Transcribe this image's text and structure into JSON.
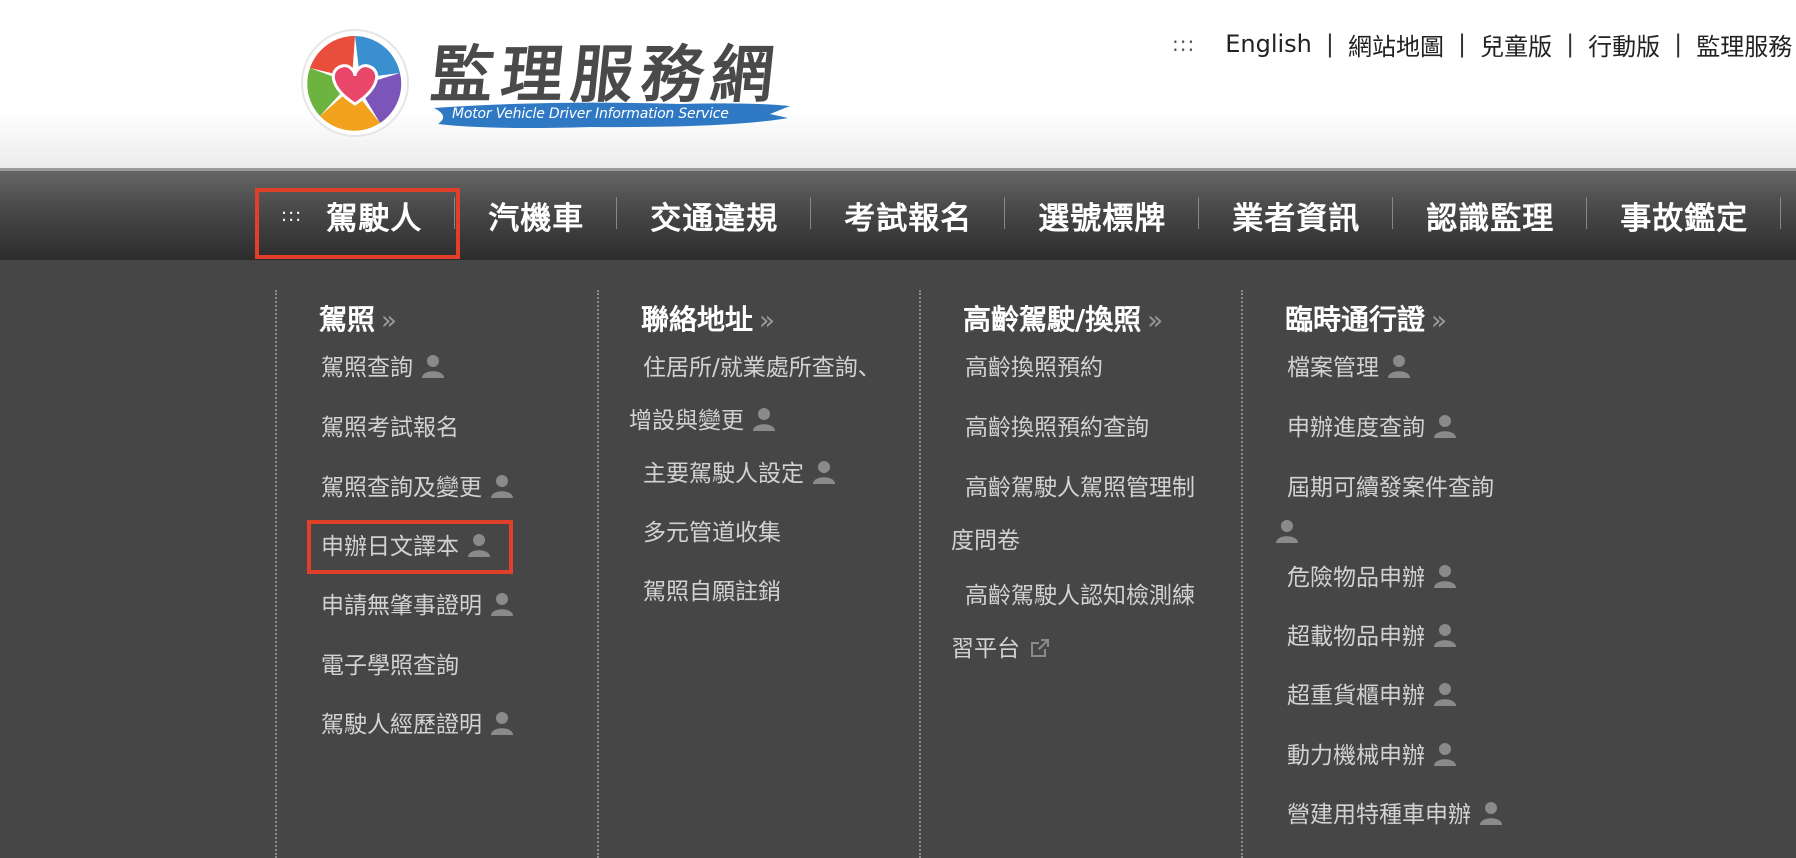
{
  "header": {
    "logo_title": "監理服務網",
    "logo_subtitle": "Motor Vehicle Driver Information Service",
    "accesskey": ":::",
    "links": [
      "English",
      "網站地圖",
      "兒童版",
      "行動版",
      "監理服務"
    ]
  },
  "nav": {
    "accesskey": ":::",
    "items": [
      "駕駛人",
      "汽機車",
      "交通違規",
      "考試報名",
      "選號標牌",
      "業者資訊",
      "認識監理",
      "事故鑑定"
    ],
    "active": "駕駛人"
  },
  "menu": {
    "col1": {
      "title": "駕照",
      "items": [
        "駕照查詢",
        "駕照考試報名",
        "駕照查詢及變更",
        "申辦日文譯本",
        "申請無肇事證明",
        "電子學照查詢",
        "駕駛人經歷證明"
      ]
    },
    "col2": {
      "title": "聯絡地址",
      "items": [
        "住居所/就業處所查詢、",
        "增設與變更",
        "主要駕駛人設定",
        "多元管道收集",
        "駕照自願註銷"
      ]
    },
    "col3": {
      "title": "高齡駕駛/換照",
      "items": [
        "高齡換照預約",
        "高齡換照預約查詢",
        "高齡駕駛人駕照管理制",
        "度問卷",
        "高齡駕駛人認知檢測練",
        "習平台"
      ]
    },
    "col4": {
      "title": "臨時通行證",
      "items": [
        "檔案管理",
        "申辦進度查詢",
        "屆期可續發案件查詢",
        "危險物品申辦",
        "超載物品申辦",
        "超重貨櫃申辦",
        "動力機械申辦",
        "營建用特種車申辦"
      ]
    },
    "chevron": "»"
  },
  "colors": {
    "highlight": "#e0402a",
    "menu_bg": "#464646"
  }
}
